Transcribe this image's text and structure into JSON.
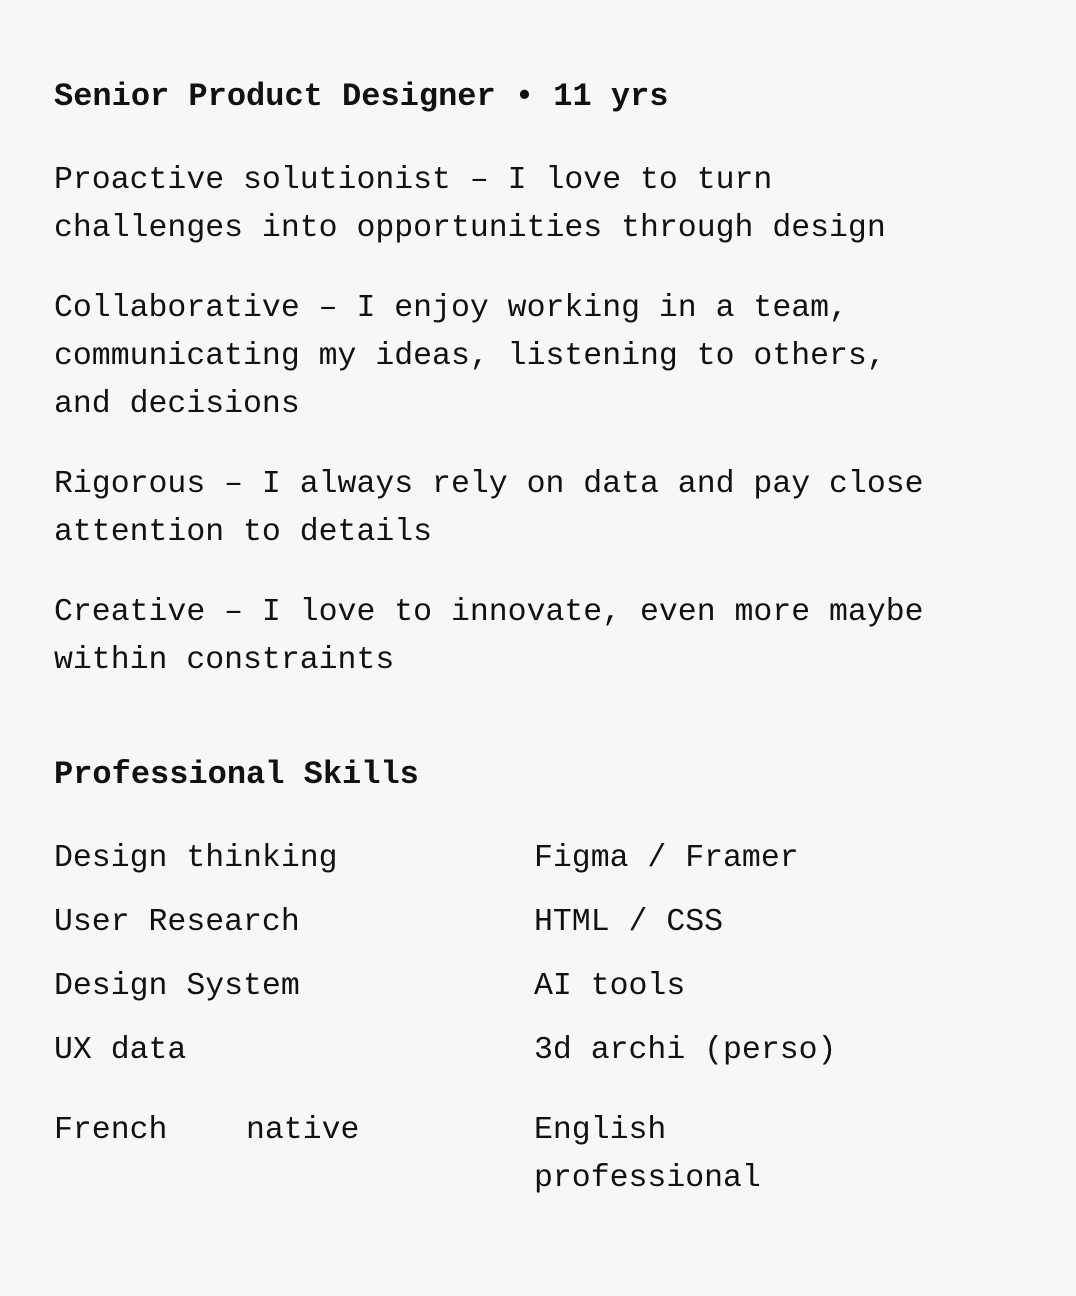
{
  "title": "Senior Product Designer • 11 yrs",
  "traits": [
    "Proactive solutionist – I love to turn challenges into opportunities through design",
    "Collaborative – I enjoy working in a team, communicating my ideas, listening to others, and decisions",
    "Rigorous – I always rely on data and pay close attention to details",
    "Creative – I love to innovate, even more maybe within constraints"
  ],
  "skills_section": {
    "title": "Professional Skills",
    "left": [
      "Design thinking",
      "User Research",
      "Design System",
      "UX data"
    ],
    "right": [
      "Figma / Framer",
      "HTML / CSS",
      "AI tools",
      "3d archi (perso)"
    ]
  },
  "languages": [
    {
      "name": "French",
      "level": "native"
    },
    {
      "name": "English",
      "level": "professional"
    }
  ]
}
